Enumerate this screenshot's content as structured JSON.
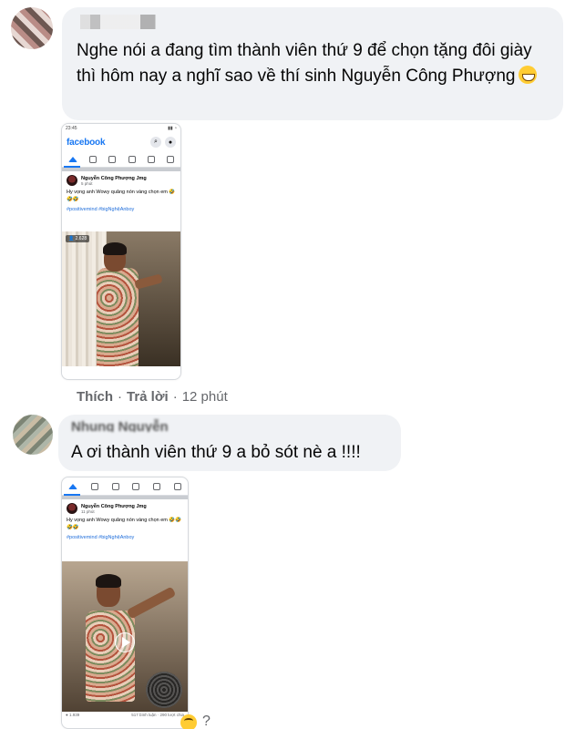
{
  "comments": [
    {
      "author": "",
      "text": "Nghe nói a đang tìm thành viên thứ 9 để chọn tặng đôi giày thì hôm nay a nghĩ sao về thí sinh Nguyễn Công Phượng",
      "emoji": "grinning-sweat-emoji",
      "actions": {
        "like": "Thích",
        "reply": "Trả lời",
        "time": "12 phút"
      },
      "attachment": {
        "status_time": "23:45",
        "app_logo": "facebook",
        "post_author": "Nguyễn Công Phượng Jmg",
        "post_time": "5 phút",
        "post_text": "Hy vọng anh Wowy quăng nón vàng chọn em 🤣🤣🤣",
        "post_tags": "#positivemind #bigNghệAnboy",
        "views": "2.628"
      }
    },
    {
      "author": "Nhung Nguyễn",
      "text": "A ơi thành viên thứ 9 a bỏ sót nè a !!!!",
      "attachment": {
        "post_author": "Nguyễn Công Phượng Jmg",
        "post_time": "11 phút",
        "post_text": "Hy vọng anh Wowy quăng nón vàng chọn em 🤣🤣🤣🤣",
        "post_tags": "#positivemind #bigNghệAnboy",
        "stats_left": "1.939",
        "stats_right": "517 bình luận · 290 lượt chia"
      },
      "trailing": "?"
    }
  ],
  "colors": {
    "bubble_bg": "#f0f2f5",
    "fb_blue": "#1877f2",
    "meta_gray": "#65676b",
    "tag_blue": "#216fdb"
  }
}
